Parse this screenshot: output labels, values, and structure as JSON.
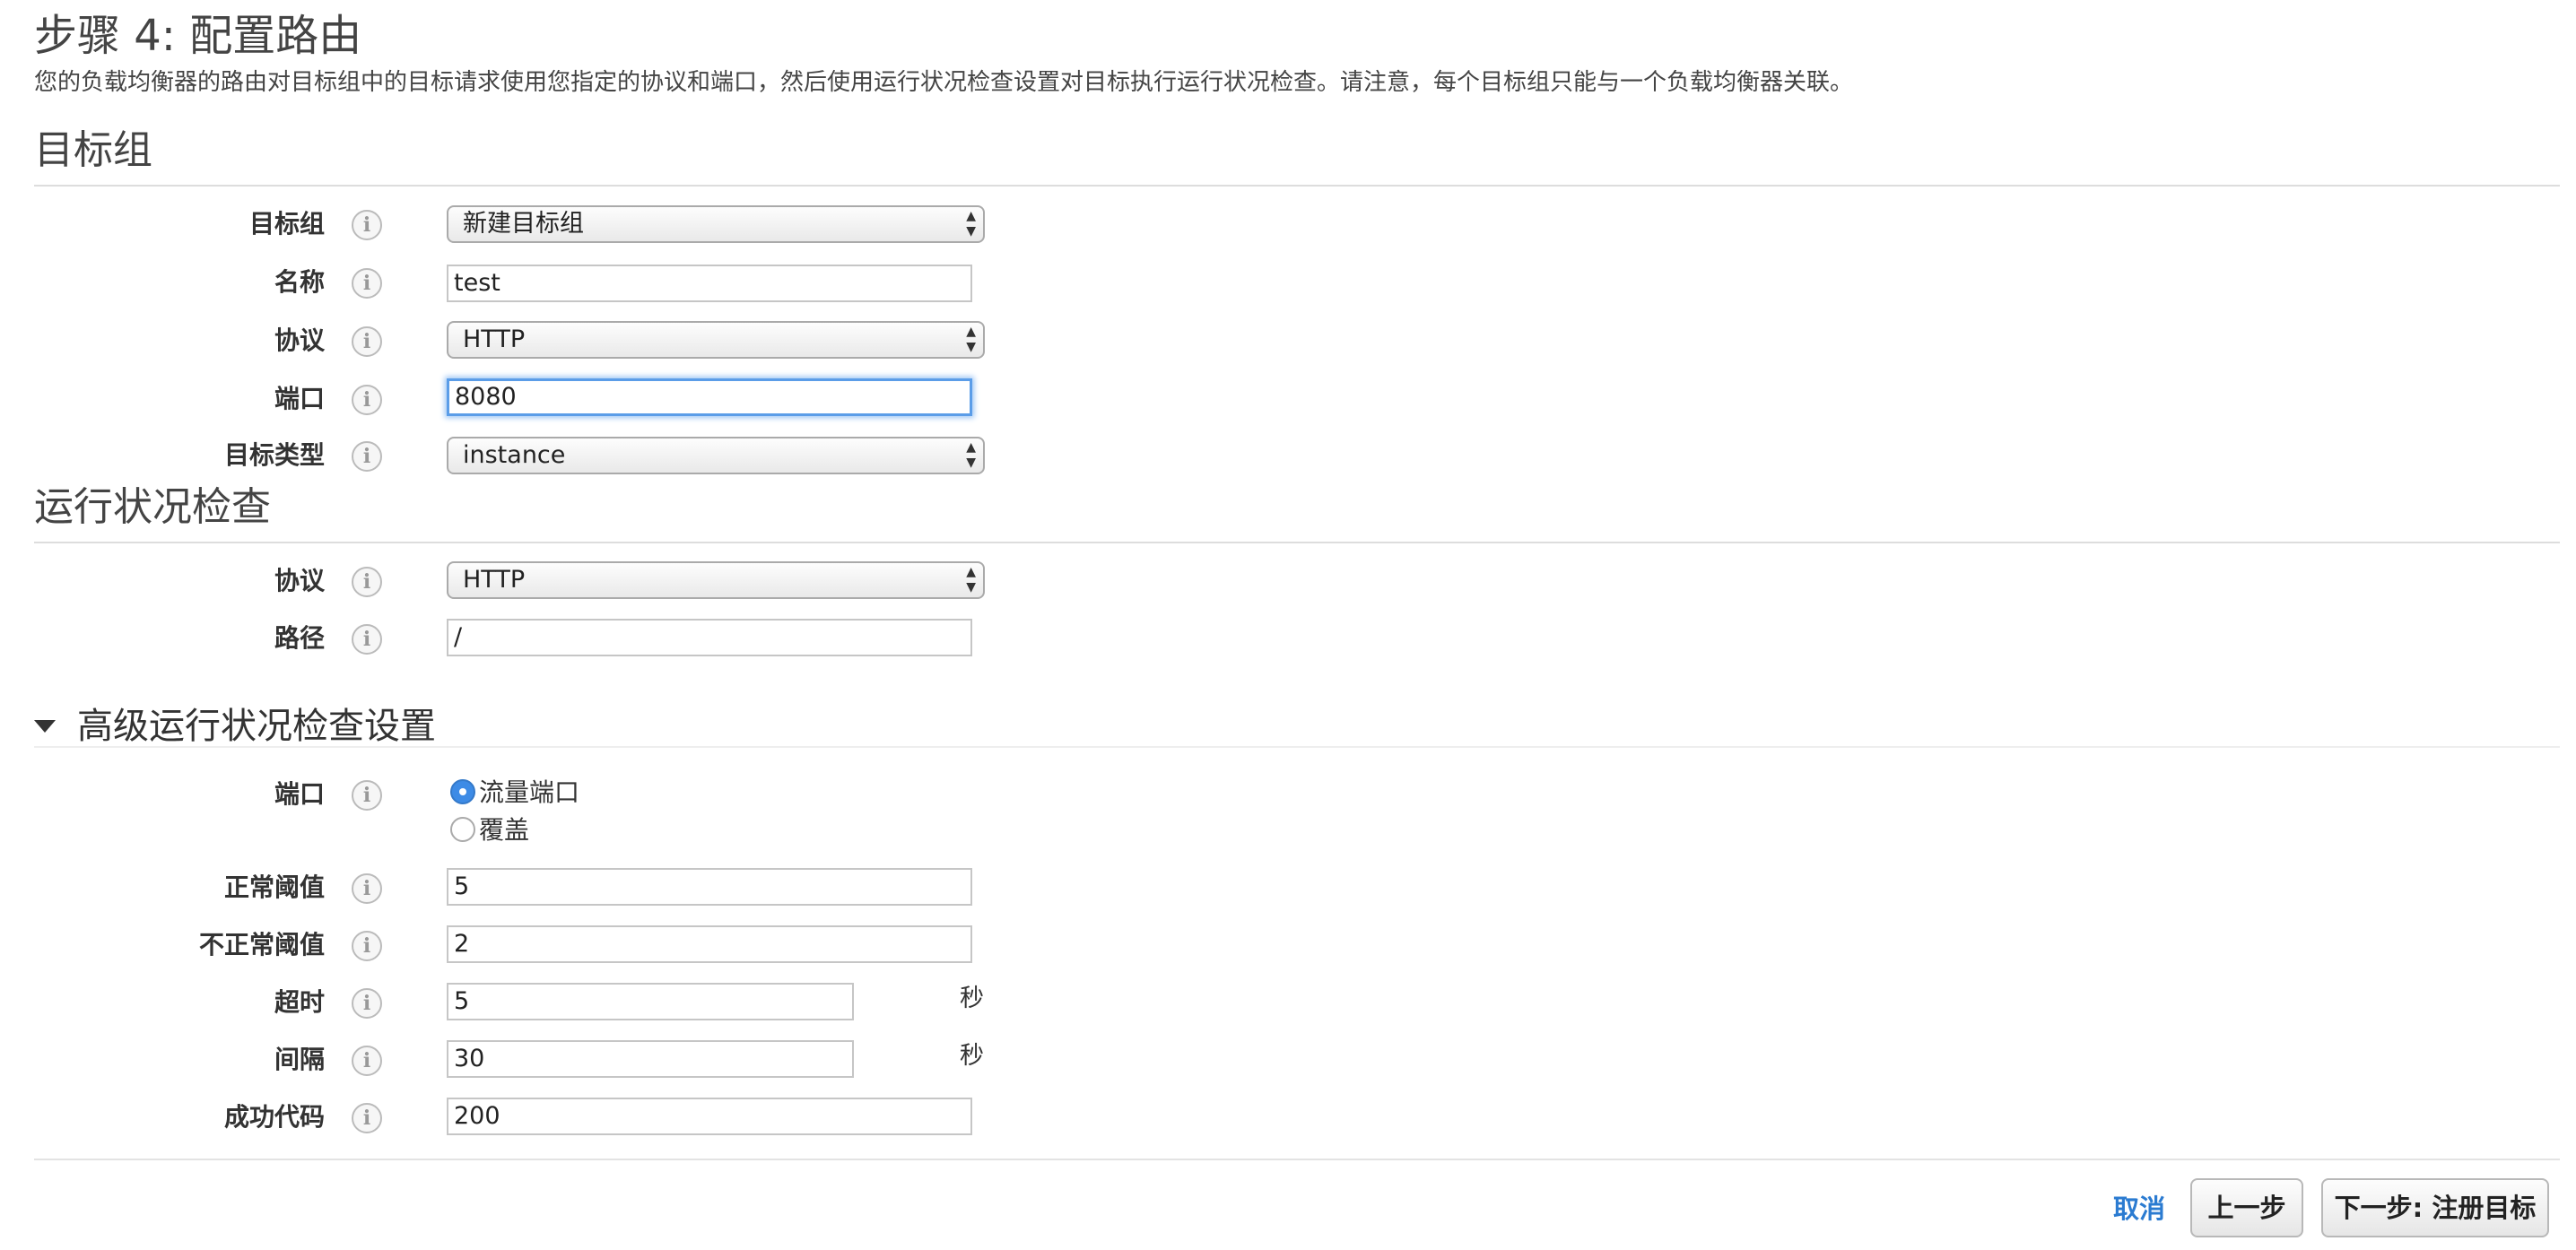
{
  "header": {
    "title": "步骤 4: 配置路由",
    "description": "您的负载均衡器的路由对目标组中的目标请求使用您指定的协议和端口，然后使用运行状况检查设置对目标执行运行状况检查。请注意，每个目标组只能与一个负载均衡器关联。"
  },
  "target_group": {
    "section_title": "目标组",
    "target_group_label": "目标组",
    "target_group_value": "新建目标组",
    "name_label": "名称",
    "name_value": "test",
    "protocol_label": "协议",
    "protocol_value": "HTTP",
    "port_label": "端口",
    "port_value": "8080",
    "target_type_label": "目标类型",
    "target_type_value": "instance"
  },
  "health_check": {
    "section_title": "运行状况检查",
    "protocol_label": "协议",
    "protocol_value": "HTTP",
    "path_label": "路径",
    "path_value": "/"
  },
  "advanced": {
    "title": "高级运行状况检查设置",
    "port_label": "端口",
    "port_options": [
      "流量端口",
      "覆盖"
    ],
    "port_selected": "流量端口",
    "healthy_threshold_label": "正常阈值",
    "healthy_threshold_value": "5",
    "unhealthy_threshold_label": "不正常阈值",
    "unhealthy_threshold_value": "2",
    "timeout_label": "超时",
    "timeout_value": "5",
    "timeout_unit": "秒",
    "interval_label": "间隔",
    "interval_value": "30",
    "interval_unit": "秒",
    "success_codes_label": "成功代码",
    "success_codes_value": "200"
  },
  "footer": {
    "cancel_label": "取消",
    "prev_label": "上一步",
    "next_label": "下一步: 注册目标"
  },
  "icons": {
    "info": "info-icon",
    "info_glyph": "i",
    "disclosure": "triangle-down-icon",
    "select_arrows": "▲▼"
  },
  "colors": {
    "link": "#2b7bd1",
    "focus": "#5b9de8",
    "radio_checked": "#3d8be6"
  }
}
